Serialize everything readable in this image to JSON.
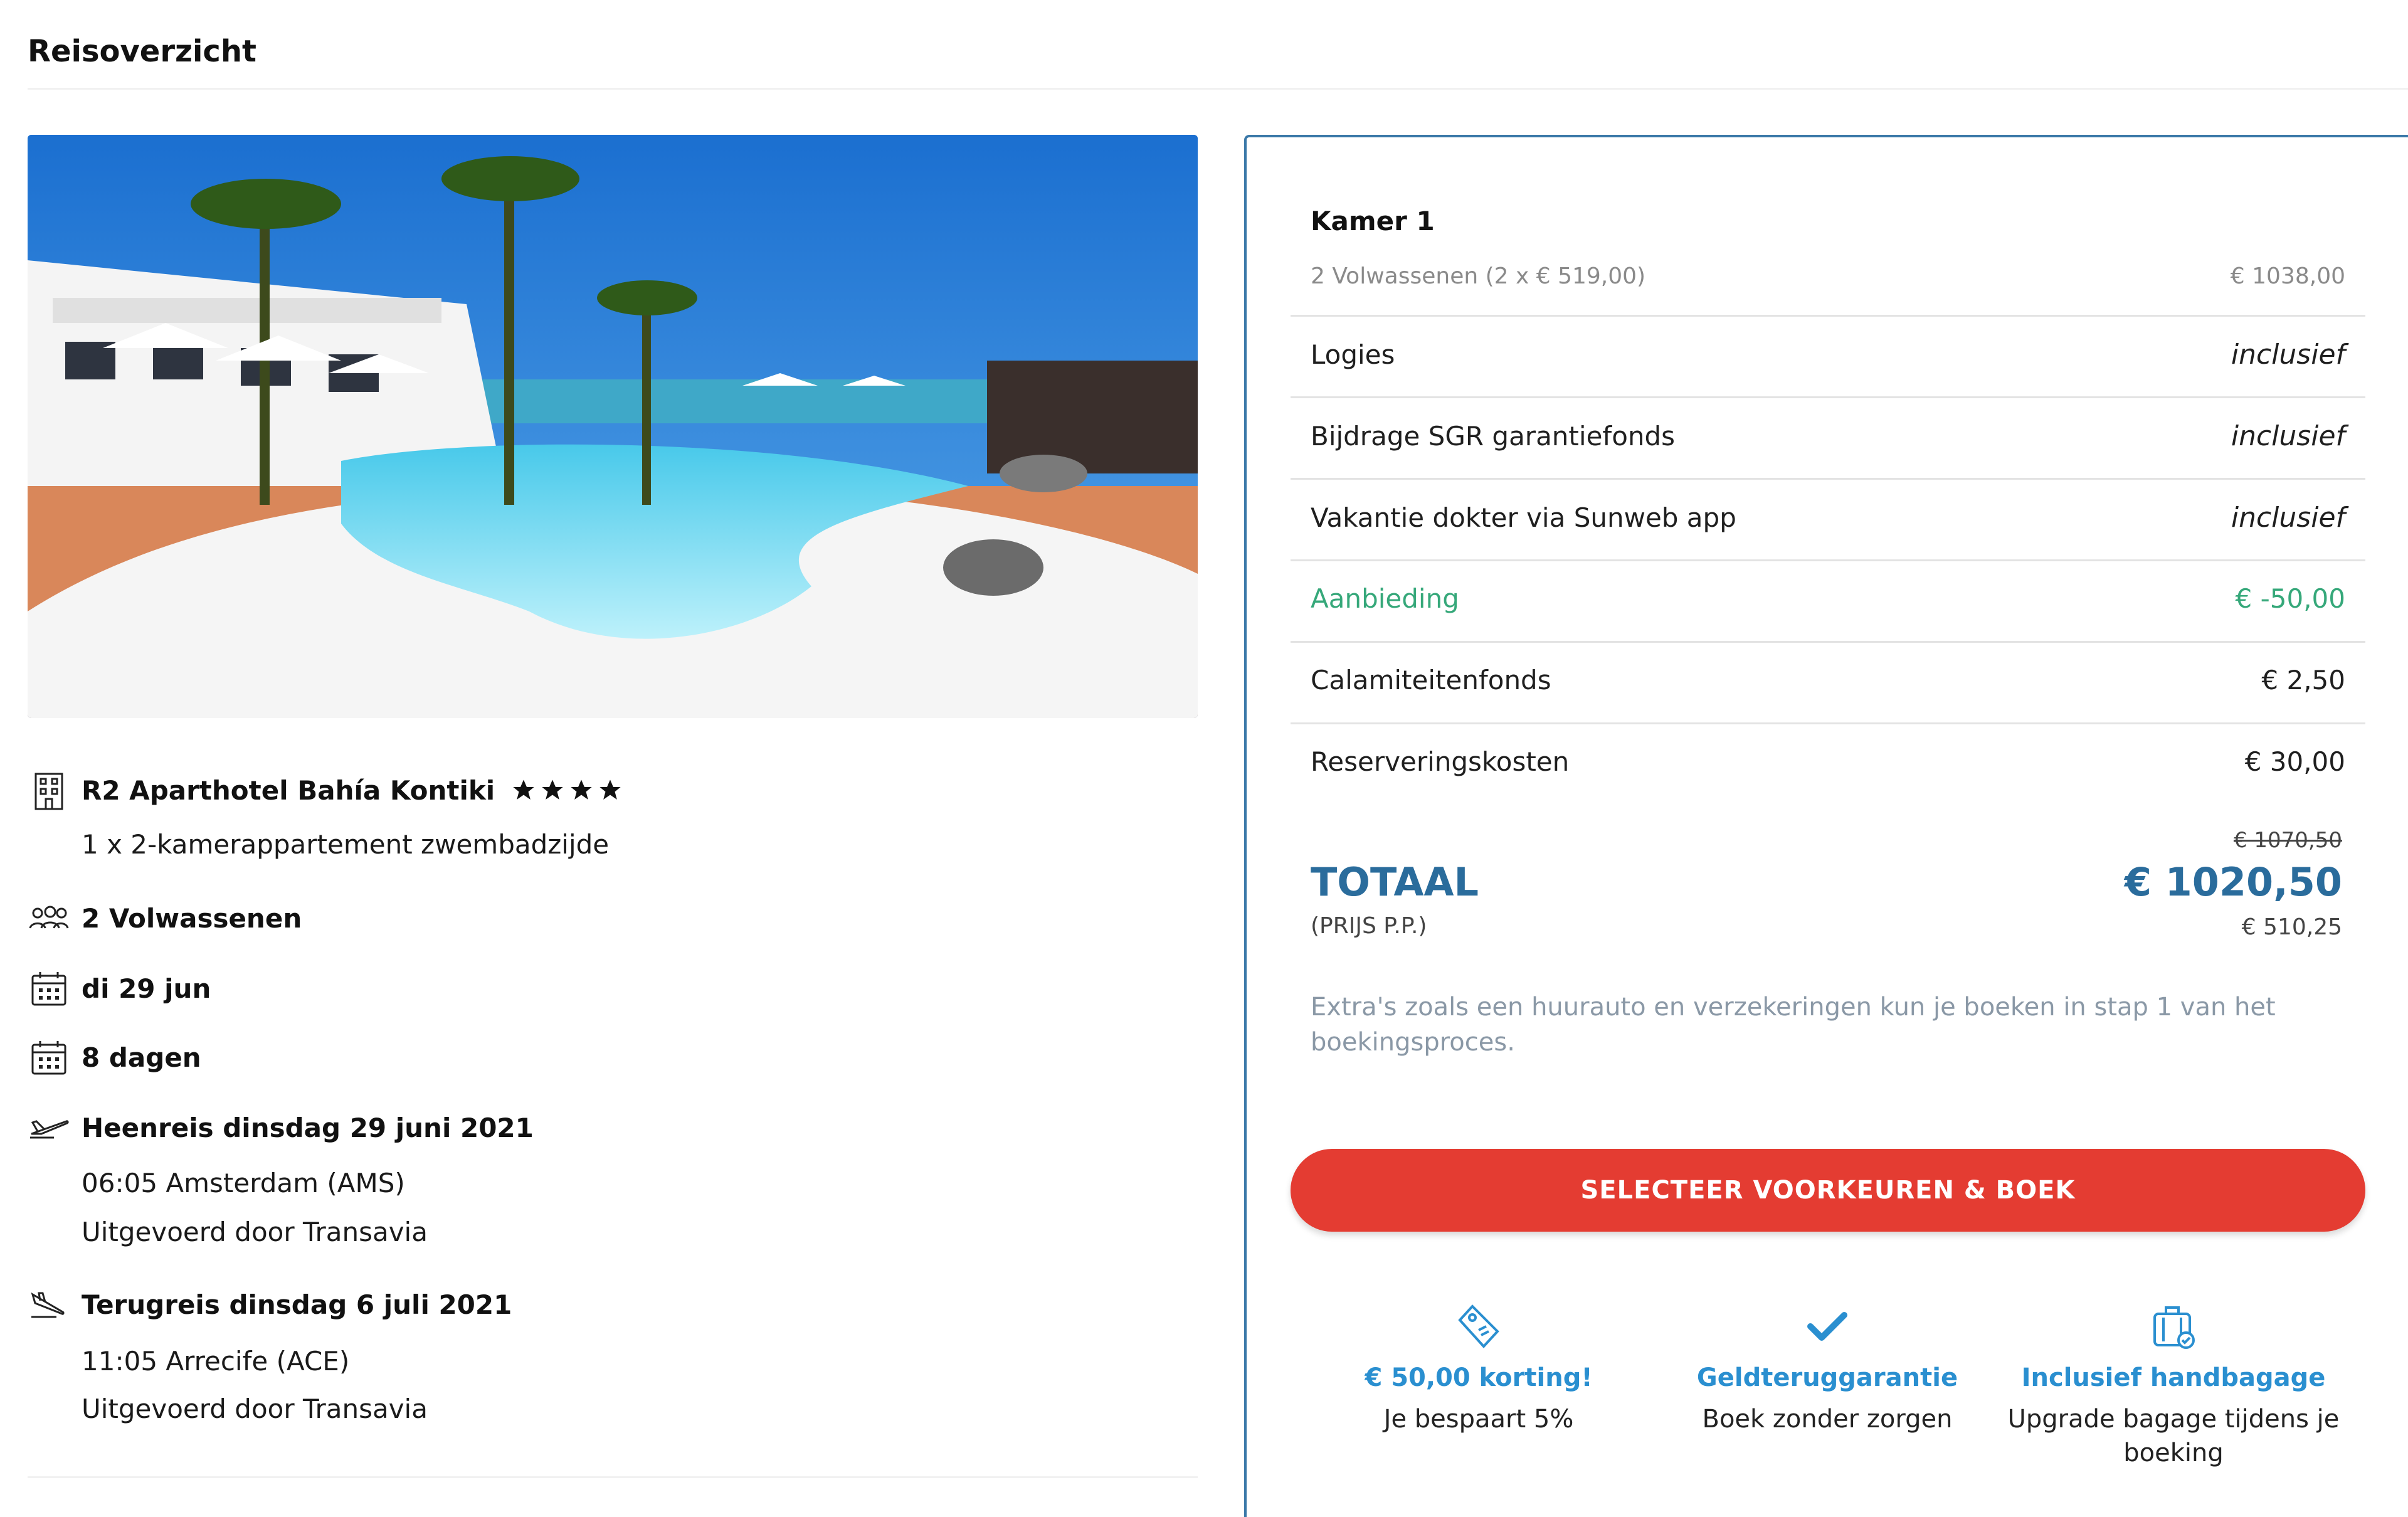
{
  "page": {
    "title": "Reisoverzicht"
  },
  "hotel": {
    "name": "R2 Aparthotel Bahía Kontiki",
    "stars": 4,
    "room": "1 x 2-kamerappartement zwembadzijde"
  },
  "travellers": "2 Volwassenen",
  "departure_date": "di 29 jun",
  "duration": "8 dagen",
  "outbound": {
    "title": "Heenreis dinsdag 29 juni 2021",
    "time_airport": "06:05 Amsterdam (AMS)",
    "carrier": "Uitgevoerd door Transavia"
  },
  "return": {
    "title": "Terugreis dinsdag 6 juli 2021",
    "time_airport": "11:05 Arrecife (ACE)",
    "carrier": "Uitgevoerd door Transavia"
  },
  "summary": {
    "room_title": "Kamer 1",
    "room_detail": "2 Volwassenen (2 x € 519,00)",
    "room_price": "€ 1038,00",
    "lines": [
      {
        "label": "Logies",
        "value": "inclusief"
      },
      {
        "label": "Bijdrage SGR garantiefonds",
        "value": "inclusief"
      },
      {
        "label": "Vakantie dokter via Sunweb app",
        "value": "inclusief"
      },
      {
        "label": "Aanbieding",
        "value": "€ -50,00"
      },
      {
        "label": "Calamiteitenfonds",
        "value": "€ 2,50"
      },
      {
        "label": "Reserveringskosten",
        "value": "€ 30,00"
      }
    ],
    "total_label": "TOTAAL",
    "per_person_label": "(PRIJS P.P.)",
    "old_total": "€ 1070,50",
    "total": "€ 1020,50",
    "per_person_price": "€ 510,25",
    "extras_note": "Extra's zoals een huurauto en verzekeringen kun je boeken in stap 1 van het boekingsproces."
  },
  "book_button": "SELECTEER VOORKEUREN & BOEK",
  "usps": [
    {
      "icon": "price-tag-icon",
      "title": "€ 50,00 korting!",
      "text": "Je bespaart 5%"
    },
    {
      "icon": "checkmark-icon",
      "title": "Geldteruggarantie",
      "text": "Boek zonder zorgen"
    },
    {
      "icon": "suitcase-icon",
      "title": "Inclusief handbagage",
      "text": "Upgrade bagage tijdens je boeking"
    }
  ],
  "colors": {
    "accent_blue": "#2a6c9c",
    "link_blue": "#2a8fd0",
    "discount_green": "#36a87a",
    "button_red": "#e43c32"
  }
}
